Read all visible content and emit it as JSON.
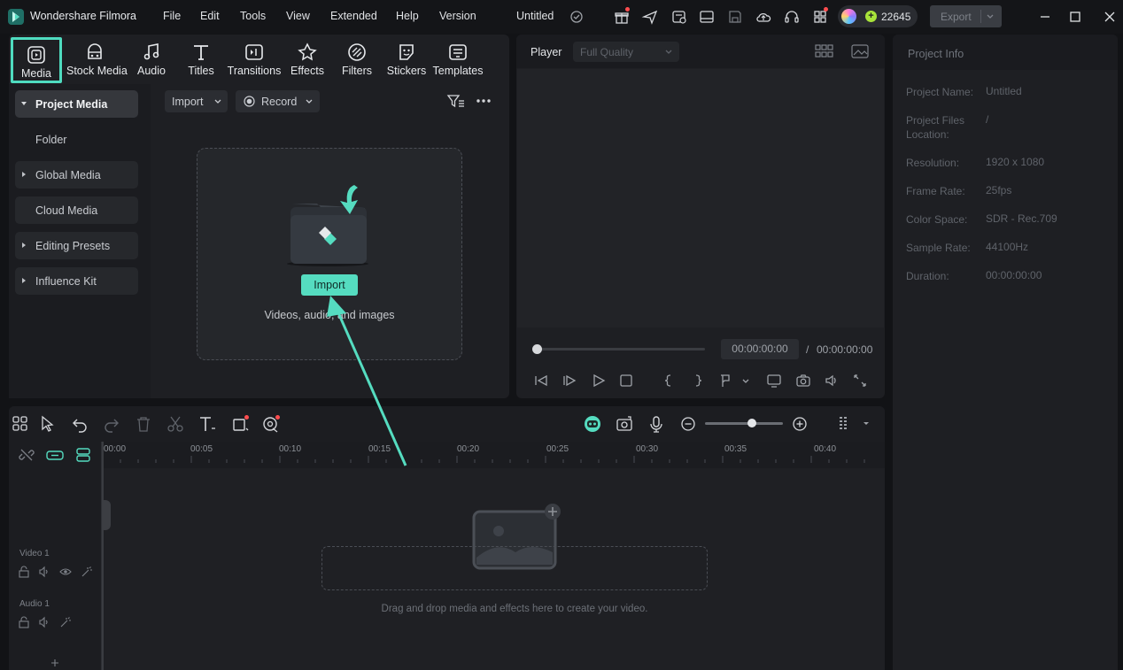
{
  "titlebar": {
    "app_name": "Wondershare Filmora",
    "menu": [
      "File",
      "Edit",
      "Tools",
      "View",
      "Extended",
      "Help",
      "Version"
    ],
    "document_title": "Untitled",
    "credits": "22645",
    "export_label": "Export"
  },
  "media_tabs": [
    {
      "label": "Media",
      "icon": "media-icon",
      "active": true
    },
    {
      "label": "Stock Media",
      "icon": "stock-media-icon"
    },
    {
      "label": "Audio",
      "icon": "music-note-icon"
    },
    {
      "label": "Titles",
      "icon": "text-t-icon"
    },
    {
      "label": "Transitions",
      "icon": "transitions-icon"
    },
    {
      "label": "Effects",
      "icon": "effects-icon"
    },
    {
      "label": "Filters",
      "icon": "filters-icon"
    },
    {
      "label": "Stickers",
      "icon": "stickers-icon"
    },
    {
      "label": "Templates",
      "icon": "templates-icon"
    }
  ],
  "sidebar": {
    "items": [
      {
        "label": "Project Media",
        "expanded": true,
        "selected": true
      },
      {
        "label": "Folder"
      },
      {
        "label": "Global Media"
      },
      {
        "label": "Cloud Media"
      },
      {
        "label": "Editing Presets"
      },
      {
        "label": "Influence Kit"
      }
    ]
  },
  "media_toolbar": {
    "import_label": "Import",
    "record_label": "Record"
  },
  "drop_zone": {
    "button_label": "Import",
    "hint": "Videos, audio, and images"
  },
  "player": {
    "label": "Player",
    "quality": "Full Quality",
    "current_time": "00:00:00:00",
    "separator": "/",
    "total_time": "00:00:00:00"
  },
  "project_info": {
    "title": "Project Info",
    "rows": [
      {
        "key": "Project Name:",
        "value": "Untitled"
      },
      {
        "key": "Project Files Location:",
        "value": "/"
      },
      {
        "key": "Resolution:",
        "value": "1920 x 1080"
      },
      {
        "key": "Frame Rate:",
        "value": "25fps"
      },
      {
        "key": "Color Space:",
        "value": "SDR - Rec.709"
      },
      {
        "key": "Sample Rate:",
        "value": "44100Hz"
      },
      {
        "key": "Duration:",
        "value": "00:00:00:00"
      }
    ]
  },
  "timeline": {
    "ruler_labels": [
      "00:00",
      "00:05",
      "00:10",
      "00:15",
      "00:20",
      "00:25",
      "00:30",
      "00:35",
      "00:40"
    ],
    "tracks": [
      {
        "name": "Video 1"
      },
      {
        "name": "Audio 1"
      }
    ],
    "drop_hint": "Drag and drop media and effects here to create your video.",
    "zoom_level": 0.55
  },
  "colors": {
    "accent": "#55dcc0",
    "background": "#121316",
    "panel": "#1e1f23"
  }
}
